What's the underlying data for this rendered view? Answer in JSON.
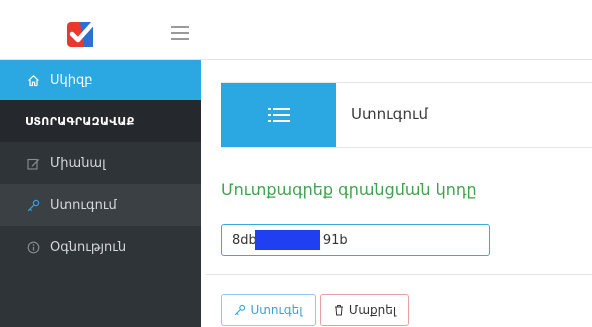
{
  "header": {
    "logo_icon": "checkmark-logo-icon",
    "menu_icon": "hamburger-icon"
  },
  "sidebar": {
    "items": [
      {
        "label": "Սկիզբ",
        "icon": "home-icon"
      },
      {
        "label": "ՍՏՈՐԱԳՐԱԶԱՎԱՔ",
        "icon": ""
      },
      {
        "label": "Միանալ",
        "icon": "edit-icon"
      },
      {
        "label": "Ստուգում",
        "icon": "key-icon"
      },
      {
        "label": "Օգնություն",
        "icon": "info-icon"
      }
    ]
  },
  "page": {
    "title": "Ստուգում",
    "title_icon": "list-icon"
  },
  "form": {
    "label": "Մուտքագրեք գրանցման կոդը",
    "code_value": "8db                91b",
    "check_button": "Ստուգել",
    "clear_button": "Մաքրել"
  },
  "colors": {
    "accent": "#2ba7e2",
    "sidebar_bg": "#2f3439",
    "label_green": "#3fa24c",
    "redaction": "#1f3ff0"
  }
}
